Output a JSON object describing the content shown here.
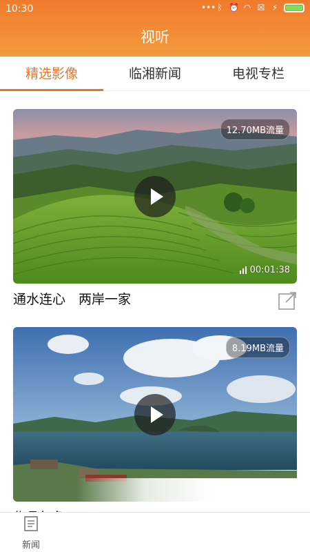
{
  "status_bar": {
    "time": "10:30"
  },
  "header": {
    "title": "视听"
  },
  "tabs": [
    {
      "label": "精选影像",
      "active": true
    },
    {
      "label": "临湘新闻",
      "active": false
    },
    {
      "label": "电视专栏",
      "active": false
    }
  ],
  "videos": [
    {
      "title": "通水连心　两岸一家",
      "size": "12.70MB流量",
      "duration": "00:01:38"
    },
    {
      "title": "作品红色",
      "size": "8.19MB流量",
      "duration": ""
    }
  ],
  "bottom_nav": [
    {
      "label": "新闻",
      "icon": "news-icon"
    }
  ],
  "colors": {
    "accent": "#e8752c",
    "header_top": "#f07a2c",
    "header_bottom": "#f59a3e"
  }
}
